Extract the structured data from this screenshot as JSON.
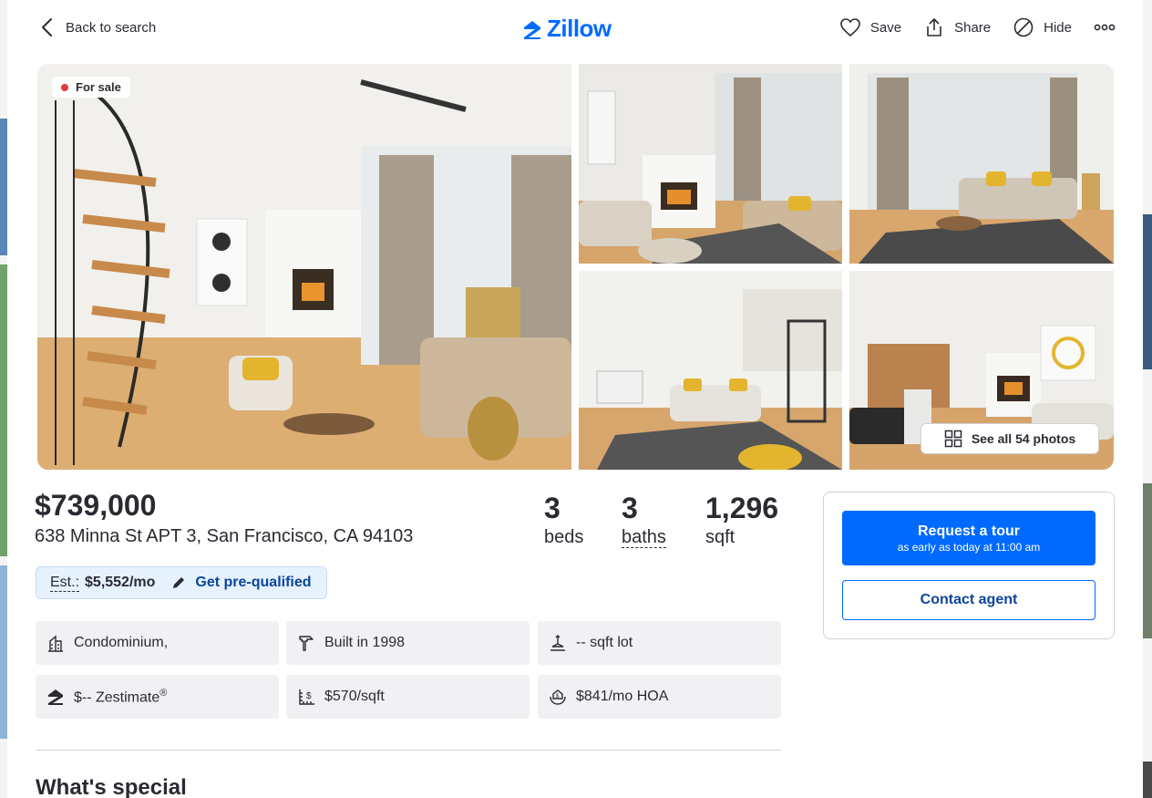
{
  "header": {
    "back_label": "Back to search",
    "logo_text": "Zillow",
    "actions": {
      "save": "Save",
      "share": "Share",
      "hide": "Hide"
    }
  },
  "gallery": {
    "status_badge": "For sale",
    "see_all_label": "See all 54 photos"
  },
  "listing": {
    "price": "$739,000",
    "address": "638 Minna St APT 3, San Francisco, CA 94103",
    "beds": {
      "value": "3",
      "label": "beds"
    },
    "baths": {
      "value": "3",
      "label": "baths"
    },
    "sqft": {
      "value": "1,296",
      "label": "sqft"
    }
  },
  "estimate": {
    "est_label": "Est.:",
    "amount": "$5,552/mo",
    "cta": "Get pre-qualified"
  },
  "facts": {
    "type": "Condominium,",
    "built": "Built in 1998",
    "lot": "-- sqft lot",
    "zestimate": "$-- Zestimate",
    "zestimate_mark": "®",
    "price_per_sqft": "$570/sqft",
    "hoa": "$841/mo HOA"
  },
  "sections": {
    "whats_special": "What's special"
  },
  "contact": {
    "tour_title": "Request a tour",
    "tour_subtitle": "as early as today at 11:00 am",
    "agent_label": "Contact agent"
  },
  "colors": {
    "brand_blue": "#006aff",
    "dark_blue": "#0d4599",
    "text": "#2a2a33",
    "for_sale_dot": "#e03a3e",
    "estimate_bg": "#e5f1fc"
  }
}
